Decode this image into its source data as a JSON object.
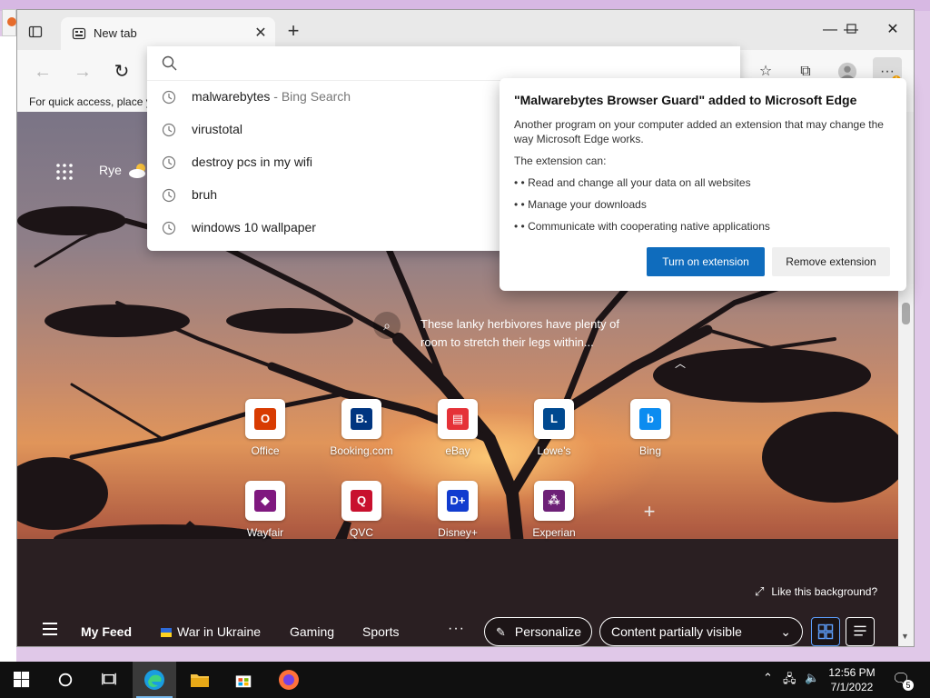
{
  "browser": {
    "tab": {
      "title": "New tab",
      "close_glyph": "✕",
      "favicon": "new-tab-icon"
    },
    "new_tab_glyph": "+",
    "window_controls": {
      "minimize": "—",
      "maximize": "☐",
      "close": "✕"
    },
    "toolbar": {
      "back_glyph": "←",
      "forward_glyph": "→",
      "refresh_glyph": "↻",
      "favorites_glyph": "☆",
      "collections_glyph": "⧉",
      "menu_glyph": "···",
      "menu_badge": "!"
    },
    "favorites_bar_msg": "For quick access, place y"
  },
  "address_dropdown": {
    "input_value": "",
    "suggestions": [
      {
        "text": "malwarebytes",
        "suffix": " - Bing Search"
      },
      {
        "text": "virustotal",
        "suffix": ""
      },
      {
        "text": "destroy pcs in my wifi",
        "suffix": ""
      },
      {
        "text": "bruh",
        "suffix": ""
      },
      {
        "text": "windows 10 wallpaper",
        "suffix": ""
      }
    ]
  },
  "extension_popup": {
    "title": "\"Malwarebytes Browser Guard\" added to Microsoft Edge",
    "description": "Another program on your computer added an extension that may change the way Microsoft Edge works.",
    "can_label": "The extension can:",
    "permissions": [
      "• • Read and change all your data on all websites",
      "• • Manage your downloads",
      "• • Communicate with cooperating native applications"
    ],
    "primary_button": "Turn on extension",
    "secondary_button": "Remove extension"
  },
  "new_tab_page": {
    "weather_city": "Rye",
    "image_caption": "These lanky herbivores have plenty of room to stretch their legs within...",
    "collapse_glyph": "︿",
    "tiles": [
      {
        "label": "Office",
        "glyph": "O",
        "color": "#d83b01"
      },
      {
        "label": "Booking.com",
        "glyph": "B.",
        "color": "#003580"
      },
      {
        "label": "eBay",
        "glyph": "▤",
        "color": "#e53238"
      },
      {
        "label": "Lowe's",
        "glyph": "L",
        "color": "#004990"
      },
      {
        "label": "Bing",
        "glyph": "b",
        "color": "#0c8cf0"
      },
      {
        "label": "Wayfair",
        "glyph": "◆",
        "color": "#7f187f"
      },
      {
        "label": "QVC",
        "glyph": "Q",
        "color": "#c8102e"
      },
      {
        "label": "Disney+",
        "glyph": "D+",
        "color": "#113ccf"
      },
      {
        "label": "Experian",
        "glyph": "⁂",
        "color": "#6d2077"
      }
    ],
    "add_tile_glyph": "+",
    "like_background": "Like this background?",
    "feed": {
      "my_feed": "My Feed",
      "war_in_ukraine": "War in Ukraine",
      "gaming": "Gaming",
      "sports": "Sports",
      "more": "···",
      "personalize": "Personalize",
      "content_visibility": "Content partially visible",
      "dropdown_glyph": "⌄"
    }
  },
  "taskbar": {
    "time": "12:56 PM",
    "date": "7/1/2022",
    "notification_count": "5"
  }
}
